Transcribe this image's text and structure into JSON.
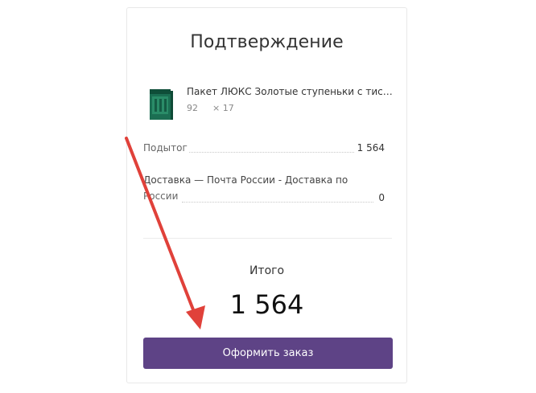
{
  "confirmation": {
    "title": "Подтверждение",
    "product": {
      "name": "Пакет ЛЮКС Золотые ступеньки с тисн...",
      "price": "92",
      "quantity": "× 17"
    },
    "subtotal": {
      "label": "Подытог",
      "value": "1 564"
    },
    "delivery": {
      "label_line1": "Доставка — Почта России - Доставка по",
      "label_line2": "России",
      "value": "0"
    },
    "total": {
      "label": "Итого",
      "value": "1 564"
    },
    "checkout_button_label": "Оформить заказ"
  },
  "colors": {
    "button": "#5e4386",
    "arrow": "#e0413a",
    "product_thumb": "#1f7a5a"
  }
}
